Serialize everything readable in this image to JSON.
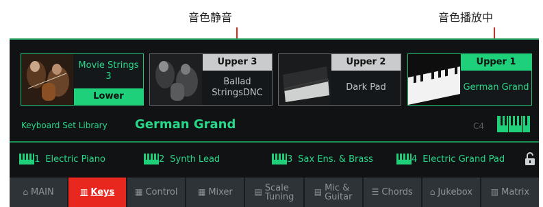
{
  "annotations": {
    "muted": "音色静音",
    "playing": "音色播放中"
  },
  "tiles": {
    "lower": {
      "name": "Movie Strings 3",
      "part": "Lower"
    },
    "upper3": {
      "part": "Upper 3",
      "name": "Ballad StringsDNC"
    },
    "upper2": {
      "part": "Upper 2",
      "name": "Dark Pad"
    },
    "upper1": {
      "part": "Upper 1",
      "name": "German Grand"
    }
  },
  "keyboard_set": {
    "label": "Keyboard Set Library",
    "value": "German Grand",
    "note": "C4"
  },
  "presets": [
    {
      "num": "1",
      "name": "Electric Piano"
    },
    {
      "num": "2",
      "name": "Synth Lead"
    },
    {
      "num": "3",
      "name": "Sax Ens. & Brass"
    },
    {
      "num": "4",
      "name": "Electric Grand Pad"
    }
  ],
  "tabs": [
    {
      "label": "MAIN",
      "icon": "home-icon"
    },
    {
      "label": "Keys",
      "icon": "keys-icon"
    },
    {
      "label": "Control",
      "icon": "control-icon"
    },
    {
      "label": "Mixer",
      "icon": "mixer-icon"
    },
    {
      "label": "Scale",
      "label2": "Tuning",
      "icon": "scale-icon"
    },
    {
      "label": "Mic &",
      "label2": "Guitar",
      "icon": "mic-icon"
    },
    {
      "label": "Chords",
      "icon": "chords-icon"
    },
    {
      "label": "Jukebox",
      "icon": "jukebox-icon"
    },
    {
      "label": "Matrix",
      "icon": "matrix-icon"
    }
  ],
  "colors": {
    "accent": "#1ed07a",
    "active_tab": "#e8281e",
    "annotation_line": "#e0221b"
  }
}
